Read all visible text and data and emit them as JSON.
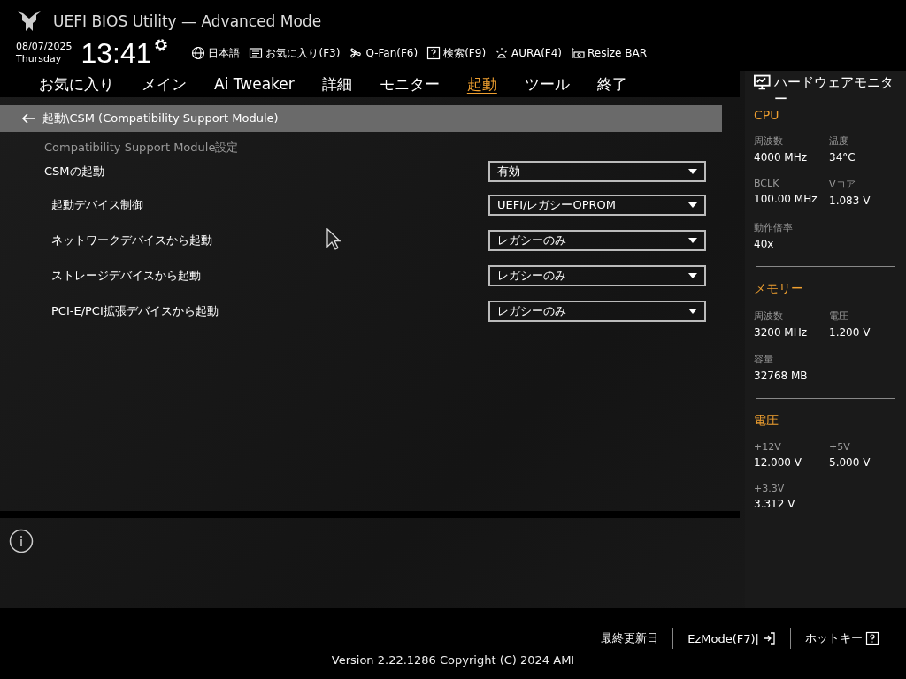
{
  "window": {
    "title": "UEFI BIOS Utility — Advanced Mode"
  },
  "clock": {
    "date": "08/07/2025",
    "weekday": "Thursday",
    "time": "13:41"
  },
  "toolbar": [
    {
      "kind": "globe",
      "label": "日本語"
    },
    {
      "kind": "list",
      "label": "お気に入り(F3)"
    },
    {
      "kind": "fan",
      "label": "Q-Fan(F6)"
    },
    {
      "kind": "help",
      "label": "検索(F9)"
    },
    {
      "kind": "light",
      "label": "AURA(F4)"
    },
    {
      "kind": "card",
      "label": "Resize BAR"
    }
  ],
  "tabs": [
    {
      "label": "お気に入り",
      "selected": false
    },
    {
      "label": "メイン",
      "selected": false
    },
    {
      "label": "Ai Tweaker",
      "selected": false
    },
    {
      "label": "詳細",
      "selected": false
    },
    {
      "label": "モニター",
      "selected": false
    },
    {
      "label": "起動",
      "selected": true
    },
    {
      "label": "ツール",
      "selected": false
    },
    {
      "label": "終了",
      "selected": false
    }
  ],
  "breadcrumb": "起動\\CSM (Compatibility Support Module)",
  "section_title": "Compatibility Support Module設定",
  "settings": [
    {
      "label": "CSMの起動",
      "value": "有効",
      "children": [
        {
          "label": "起動デバイス制御",
          "value": "UEFI/レガシーOPROM"
        },
        {
          "label": "ネットワークデバイスから起動",
          "value": "レガシーのみ"
        },
        {
          "label": "ストレージデバイスから起動",
          "value": "レガシーのみ"
        },
        {
          "label": "PCI-E/PCI拡張デバイスから起動",
          "value": "レガシーのみ"
        }
      ]
    }
  ],
  "hardware_monitor": {
    "title": "ハードウェアモニター",
    "sections": [
      {
        "title": "CPU",
        "items": [
          {
            "label": "周波数",
            "value": "4000 MHz"
          },
          {
            "label": "温度",
            "value": "34°C"
          },
          {
            "label": "BCLK",
            "value": "100.00 MHz"
          },
          {
            "label": "Vコア",
            "value": "1.083 V"
          },
          {
            "label": "動作倍率",
            "value": "40x"
          }
        ]
      },
      {
        "title": "メモリー",
        "items": [
          {
            "label": "周波数",
            "value": "3200 MHz"
          },
          {
            "label": "電圧",
            "value": "1.200 V"
          },
          {
            "label": "容量",
            "value": "32768 MB"
          }
        ]
      },
      {
        "title": "電圧",
        "items": [
          {
            "label": "+12V",
            "value": "12.000 V"
          },
          {
            "label": "+5V",
            "value": "5.000 V"
          },
          {
            "label": "+3.3V",
            "value": "3.312 V"
          }
        ]
      }
    ]
  },
  "footer": {
    "links": [
      {
        "kind": "plain",
        "label": "最終更新日"
      },
      {
        "kind": "exit",
        "label": "EzMode(F7)|"
      },
      {
        "kind": "help",
        "label": "ホットキー"
      }
    ],
    "version": "Version 2.22.1286 Copyright (C) 2024 AMI"
  }
}
